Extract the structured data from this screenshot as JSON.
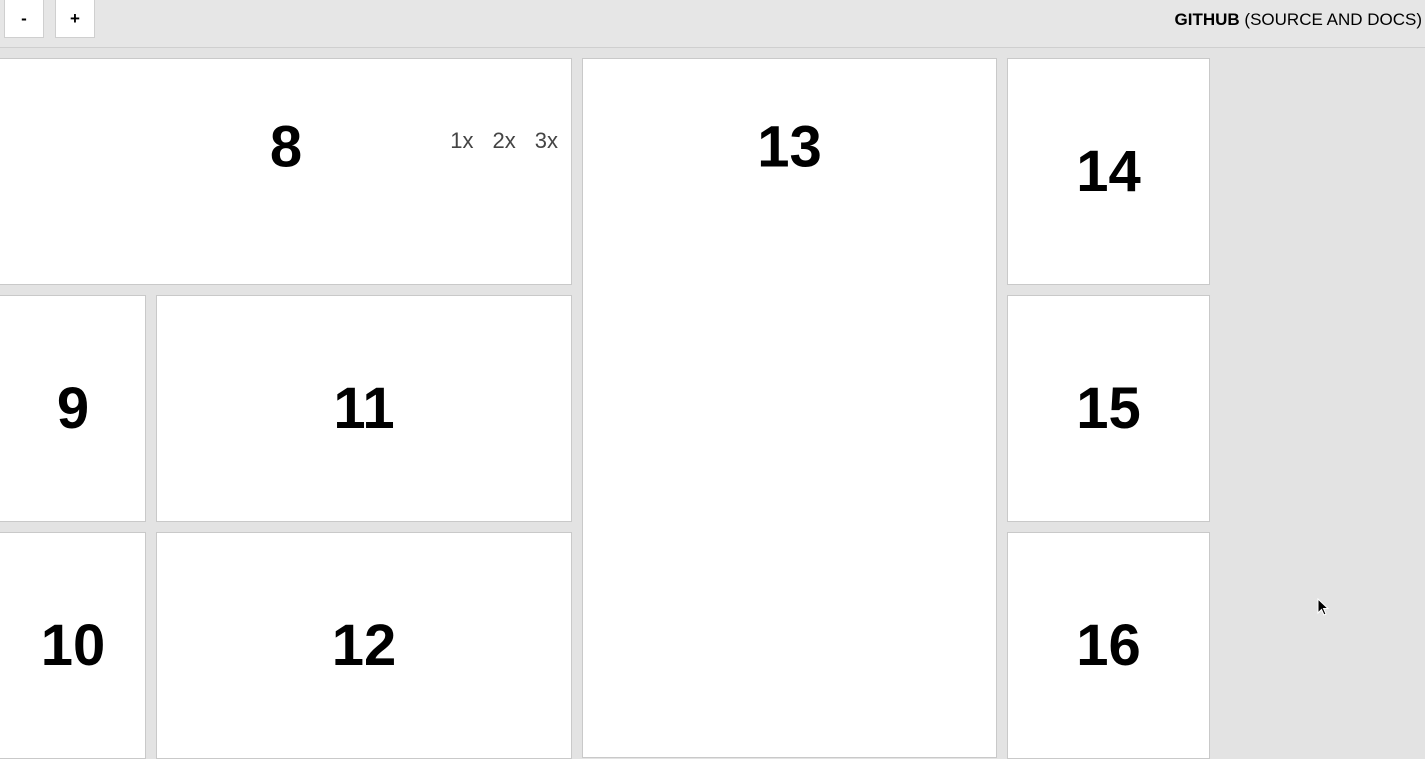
{
  "toolbar": {
    "zoom_out_label": "-",
    "zoom_in_label": "+",
    "github_bold": "GITHUB",
    "github_rest": " (SOURCE AND DOCS)"
  },
  "speeds": [
    "1x",
    "2x",
    "3x"
  ],
  "tiles": {
    "t8": "8",
    "t9": "9",
    "t10": "10",
    "t11": "11",
    "t12": "12",
    "t13": "13",
    "t14": "14",
    "t15": "15",
    "t16": "16"
  }
}
